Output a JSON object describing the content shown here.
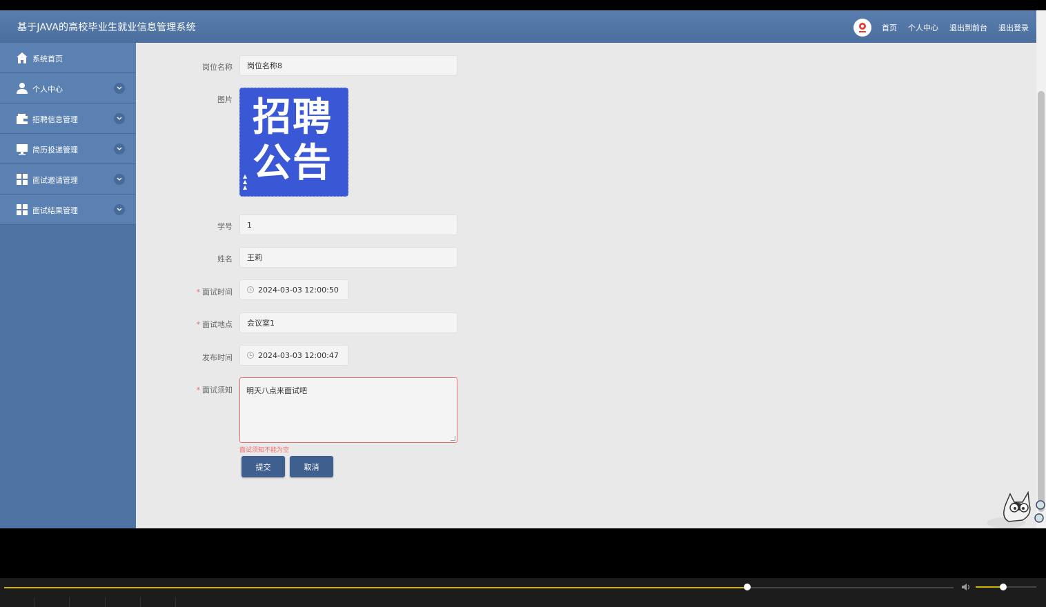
{
  "header": {
    "title": "基于JAVA的高校毕业生就业信息管理系统",
    "nav": [
      "首页",
      "个人中心",
      "退出到前台",
      "退出登录"
    ]
  },
  "sidebar": {
    "items": [
      {
        "label": "系统首页",
        "icon": "home-icon",
        "has_chevron": false
      },
      {
        "label": "个人中心",
        "icon": "user-icon",
        "has_chevron": true
      },
      {
        "label": "招聘信息管理",
        "icon": "wallet-icon",
        "has_chevron": true
      },
      {
        "label": "简历投递管理",
        "icon": "monitor-icon",
        "has_chevron": true
      },
      {
        "label": "面试邀请管理",
        "icon": "grid-icon",
        "has_chevron": true
      },
      {
        "label": "面试结果管理",
        "icon": "grid-icon",
        "has_chevron": true
      }
    ]
  },
  "form": {
    "position_name": {
      "label": "岗位名称",
      "value": "岗位名称8"
    },
    "image": {
      "label": "图片",
      "poster_text": "招聘公告"
    },
    "student_id": {
      "label": "学号",
      "value": "1"
    },
    "name": {
      "label": "姓名",
      "value": "王莉"
    },
    "interview_time": {
      "label": "面试时间",
      "value": "2024-03-03 12:00:50",
      "required": true
    },
    "interview_place": {
      "label": "面试地点",
      "value": "会议室1",
      "required": true
    },
    "publish_time": {
      "label": "发布时间",
      "value": "2024-03-03 12:00:47"
    },
    "interview_notice": {
      "label": "面试须知",
      "value": "明天八点来面试吧",
      "required": true,
      "error": "面试须知不能为空"
    },
    "required_mark": "*",
    "submit_label": "提交",
    "cancel_label": "取消"
  },
  "player": {
    "progress": 0.783,
    "volume": 0.45,
    "accent_color": "#d6b300"
  },
  "colors": {
    "header": "#4f74a4",
    "sidebar": "#5a81b1",
    "button": "#3f5f8f",
    "error": "#f56c6c"
  }
}
